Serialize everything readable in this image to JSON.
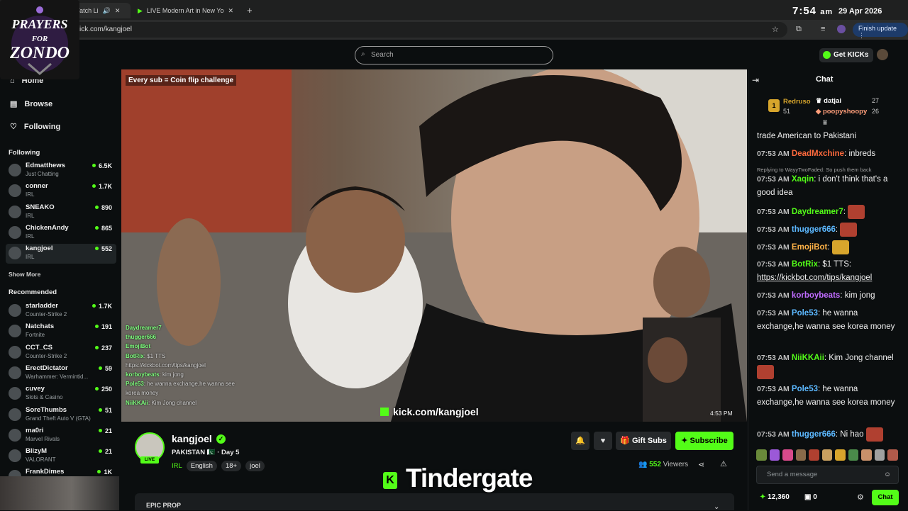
{
  "browser": {
    "tabs": [
      {
        "label": "Watch Li"
      },
      {
        "label": "LIVE Modern Art in New Yo"
      }
    ],
    "url": "ick.com/kangjoel",
    "finish_update": "Finish update"
  },
  "clock": {
    "time": "7:54",
    "ampm": "am",
    "date": "29 Apr 2026"
  },
  "logo": {
    "line1": "PRAYERS",
    "line2": "FOR",
    "line3": "ZONDO"
  },
  "header": {
    "search_placeholder": "Search",
    "get_kicks": "Get KICKs"
  },
  "sidebar": {
    "nav": [
      {
        "label": "Home"
      },
      {
        "label": "Browse"
      },
      {
        "label": "Following"
      }
    ],
    "following_title": "Following",
    "following": [
      {
        "name": "Edmatthews",
        "category": "Just Chatting",
        "viewers": "6.5K"
      },
      {
        "name": "conner",
        "category": "IRL",
        "viewers": "1.7K"
      },
      {
        "name": "SNEAKO",
        "category": "IRL",
        "viewers": "890"
      },
      {
        "name": "ChickenAndy",
        "category": "IRL",
        "viewers": "865"
      },
      {
        "name": "kangjoel",
        "category": "IRL",
        "viewers": "552"
      }
    ],
    "show_more": "Show More",
    "recommended_title": "Recommended",
    "recommended": [
      {
        "name": "starladder",
        "category": "Counter-Strike 2",
        "viewers": "1.7K"
      },
      {
        "name": "Natchats",
        "category": "Fortnite",
        "viewers": "191"
      },
      {
        "name": "CCT_CS",
        "category": "Counter-Strike 2",
        "viewers": "237"
      },
      {
        "name": "ErectDictator",
        "category": "Warhammer: Vermintid...",
        "viewers": "59"
      },
      {
        "name": "cuvey",
        "category": "Slots & Casino",
        "viewers": "250"
      },
      {
        "name": "SoreThumbs",
        "category": "Grand Theft Auto V (GTA)",
        "viewers": "51"
      },
      {
        "name": "ma0ri",
        "category": "Marvel Rivals",
        "viewers": "21"
      },
      {
        "name": "BlizyM",
        "category": "VALORANT",
        "viewers": "21"
      },
      {
        "name": "FrankDimes",
        "category": "Slots & C...",
        "viewers": "1K"
      }
    ]
  },
  "video": {
    "caption": "Every sub = Coin flip challenge",
    "overlay_url": "kick.com/kangjoel",
    "time": "4:53 PM",
    "overlay_chat": [
      {
        "user": "Daydreamer7",
        "text": ""
      },
      {
        "user": "thugger666",
        "text": ""
      },
      {
        "user": "EmojiBot",
        "text": ""
      },
      {
        "user": "BotRix",
        "text": ": $1 TTS"
      },
      {
        "user": "",
        "text": "https://kickbot.com/tips/kangjoel"
      },
      {
        "user": "korboybeats",
        "text": ": kim jong"
      },
      {
        "user": "Pole53",
        "text": ": he wanna exchange,he wanna see"
      },
      {
        "user": "",
        "text": "korea money"
      },
      {
        "user": "NiiKKAii",
        "text": ": Kim Jong channel"
      }
    ]
  },
  "stream": {
    "streamer": "kangjoel",
    "live": "LIVE",
    "title": "PAKISTAN 🇵🇰 · Day 5",
    "category": "IRL",
    "tags": [
      "English",
      "18+",
      "joel"
    ],
    "gift_subs": "Gift Subs",
    "subscribe": "Subscribe",
    "viewer_count": "552",
    "viewers_label": "Viewers",
    "section_title": "EPIC PROP"
  },
  "overlay_banner": {
    "text": "Tindergate",
    "k": "K"
  },
  "chat": {
    "title": "Chat",
    "leaders": [
      {
        "name": "Redruso",
        "count": "51"
      },
      {
        "name": "datjai",
        "count": "27"
      },
      {
        "name": "poopyshoopy",
        "count": "26"
      }
    ],
    "leader_rank": "1",
    "reply_to": "Replying to WayyTwoFaded: So push them back",
    "messages": [
      {
        "time": "",
        "user": "",
        "color": "#f0f0f0",
        "text": "trade American to Pakistani"
      },
      {
        "time": "07:53 AM",
        "user": "DeadMxchine",
        "color": "#ff6a3d",
        "text": ": inbreds"
      },
      {
        "time": "07:53 AM",
        "user": "Xaqin",
        "color": "#53fc18",
        "text": ": i don't think that's a good idea"
      },
      {
        "time": "07:53 AM",
        "user": "Daydreamer7",
        "color": "#53fc18",
        "text": ":"
      },
      {
        "time": "07:53 AM",
        "user": "thugger666",
        "color": "#5cb8ff",
        "text": ":"
      },
      {
        "time": "07:53 AM",
        "user": "EmojiBot",
        "color": "#ffb347",
        "text": ":"
      },
      {
        "time": "07:53 AM",
        "user": "BotRix",
        "color": "#53fc18",
        "text": ": $1 TTS:"
      },
      {
        "time": "",
        "user": "",
        "color": "#f0f0f0",
        "text": "https://kickbot.com/tips/kangjoel"
      },
      {
        "time": "07:53 AM",
        "user": "korboybeats",
        "color": "#c06cff",
        "text": ": kim jong"
      },
      {
        "time": "07:53 AM",
        "user": "Pole53",
        "color": "#5cb8ff",
        "text": ": he wanna exchange,he wanna see korea money"
      },
      {
        "time": "07:53 AM",
        "user": "NiiKKAii",
        "color": "#53fc18",
        "text": ": Kim Jong channel"
      },
      {
        "time": "07:53 AM",
        "user": "Pole53",
        "color": "#5cb8ff",
        "text": ": he wanna exchange,he wanna see korea money"
      },
      {
        "time": "07:53 AM",
        "user": "thugger666",
        "color": "#5cb8ff",
        "text": ": Ni hao"
      }
    ],
    "input_placeholder": "Send a message",
    "points": "12,360",
    "gifts": "0",
    "chat_button": "Chat"
  },
  "colors": {
    "accent": "#53fc18",
    "bg": "#0b0e0f"
  }
}
